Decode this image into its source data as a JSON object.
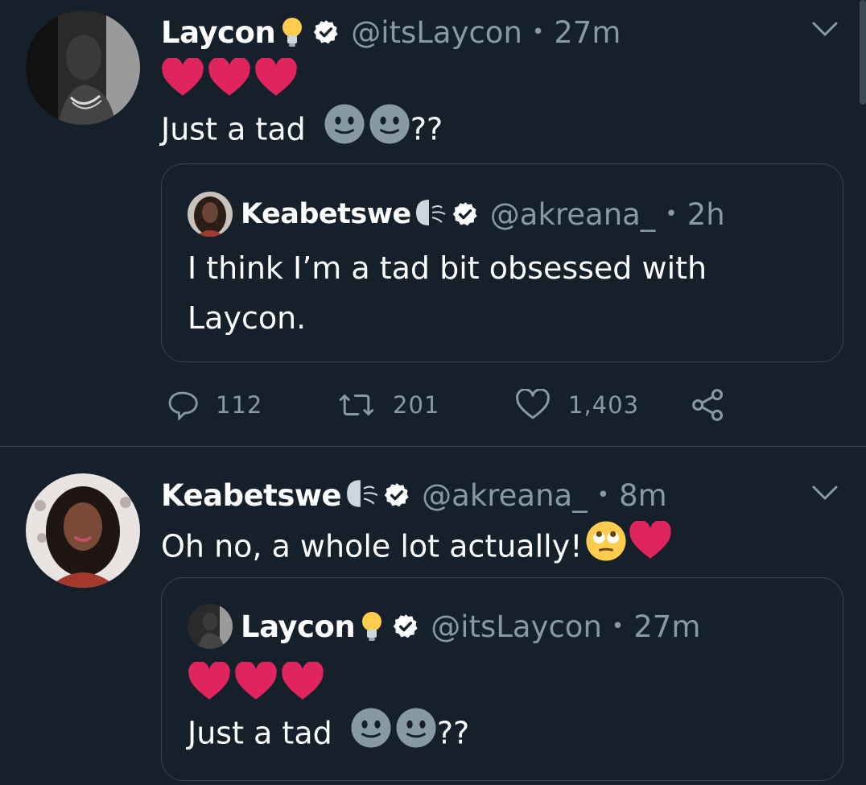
{
  "tweet1": {
    "author": {
      "name": "Laycon",
      "name_emoji": "💡",
      "handle": "@itsLaycon",
      "time": "27m"
    },
    "hearts": "❤❤❤",
    "text": "Just a tad",
    "text_suffix": "??",
    "quote": {
      "author": {
        "name": "Keabetswe",
        "handle": "@akreana_",
        "time": "2h"
      },
      "text_line1": "I think I’m a tad bit obsessed with",
      "text_line2": "Laycon."
    },
    "actions": {
      "replies": "112",
      "retweets": "201",
      "likes": "1,403"
    }
  },
  "tweet2": {
    "author": {
      "name": "Keabetswe",
      "handle": "@akreana_",
      "time": "8m"
    },
    "text": "Oh no, a whole lot actually!",
    "quote": {
      "author": {
        "name": "Laycon",
        "name_emoji": "💡",
        "handle": "@itsLaycon",
        "time": "27m"
      },
      "hearts": "❤❤❤",
      "text": "Just a tad",
      "text_suffix": "??"
    }
  },
  "sep_char": "•",
  "colors": {
    "background": "#15202b",
    "border": "#38444d",
    "muted": "#8899a6",
    "heart": "#e0245e"
  },
  "icons": [
    "verified-badge-icon",
    "chevron-down-icon",
    "reply-icon",
    "retweet-icon",
    "like-icon",
    "share-icon",
    "lightbulb-icon",
    "face-without-mouth-icon",
    "rolling-eyes-icon"
  ]
}
